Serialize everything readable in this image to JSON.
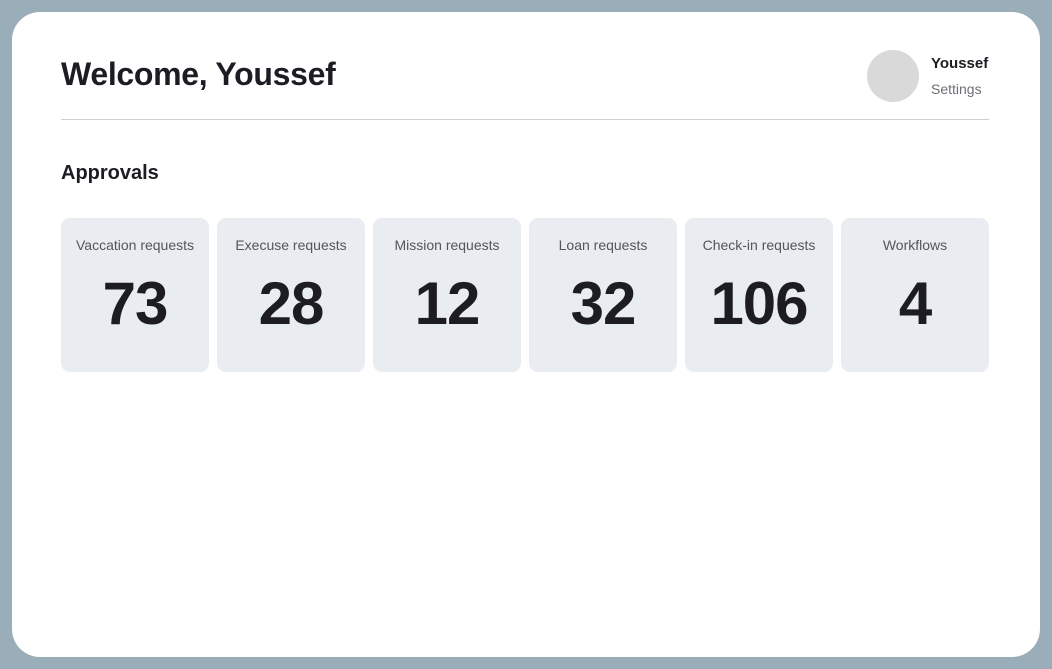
{
  "header": {
    "title": "Welcome, Youssef",
    "user": {
      "name": "Youssef",
      "settings_label": "Settings"
    }
  },
  "approvals": {
    "title": "Approvals",
    "cards": [
      {
        "label": "Vaccation requests",
        "value": "73"
      },
      {
        "label": "Execuse requests",
        "value": "28"
      },
      {
        "label": "Mission requests",
        "value": "12"
      },
      {
        "label": "Loan requests",
        "value": "32"
      },
      {
        "label": "Check-in requests",
        "value": "106"
      },
      {
        "label": "Workflows",
        "value": "4"
      }
    ]
  },
  "colors": {
    "frame": "#9aaeb9",
    "card_background": "#e9ecf1",
    "avatar_placeholder": "#d9d9d9"
  }
}
